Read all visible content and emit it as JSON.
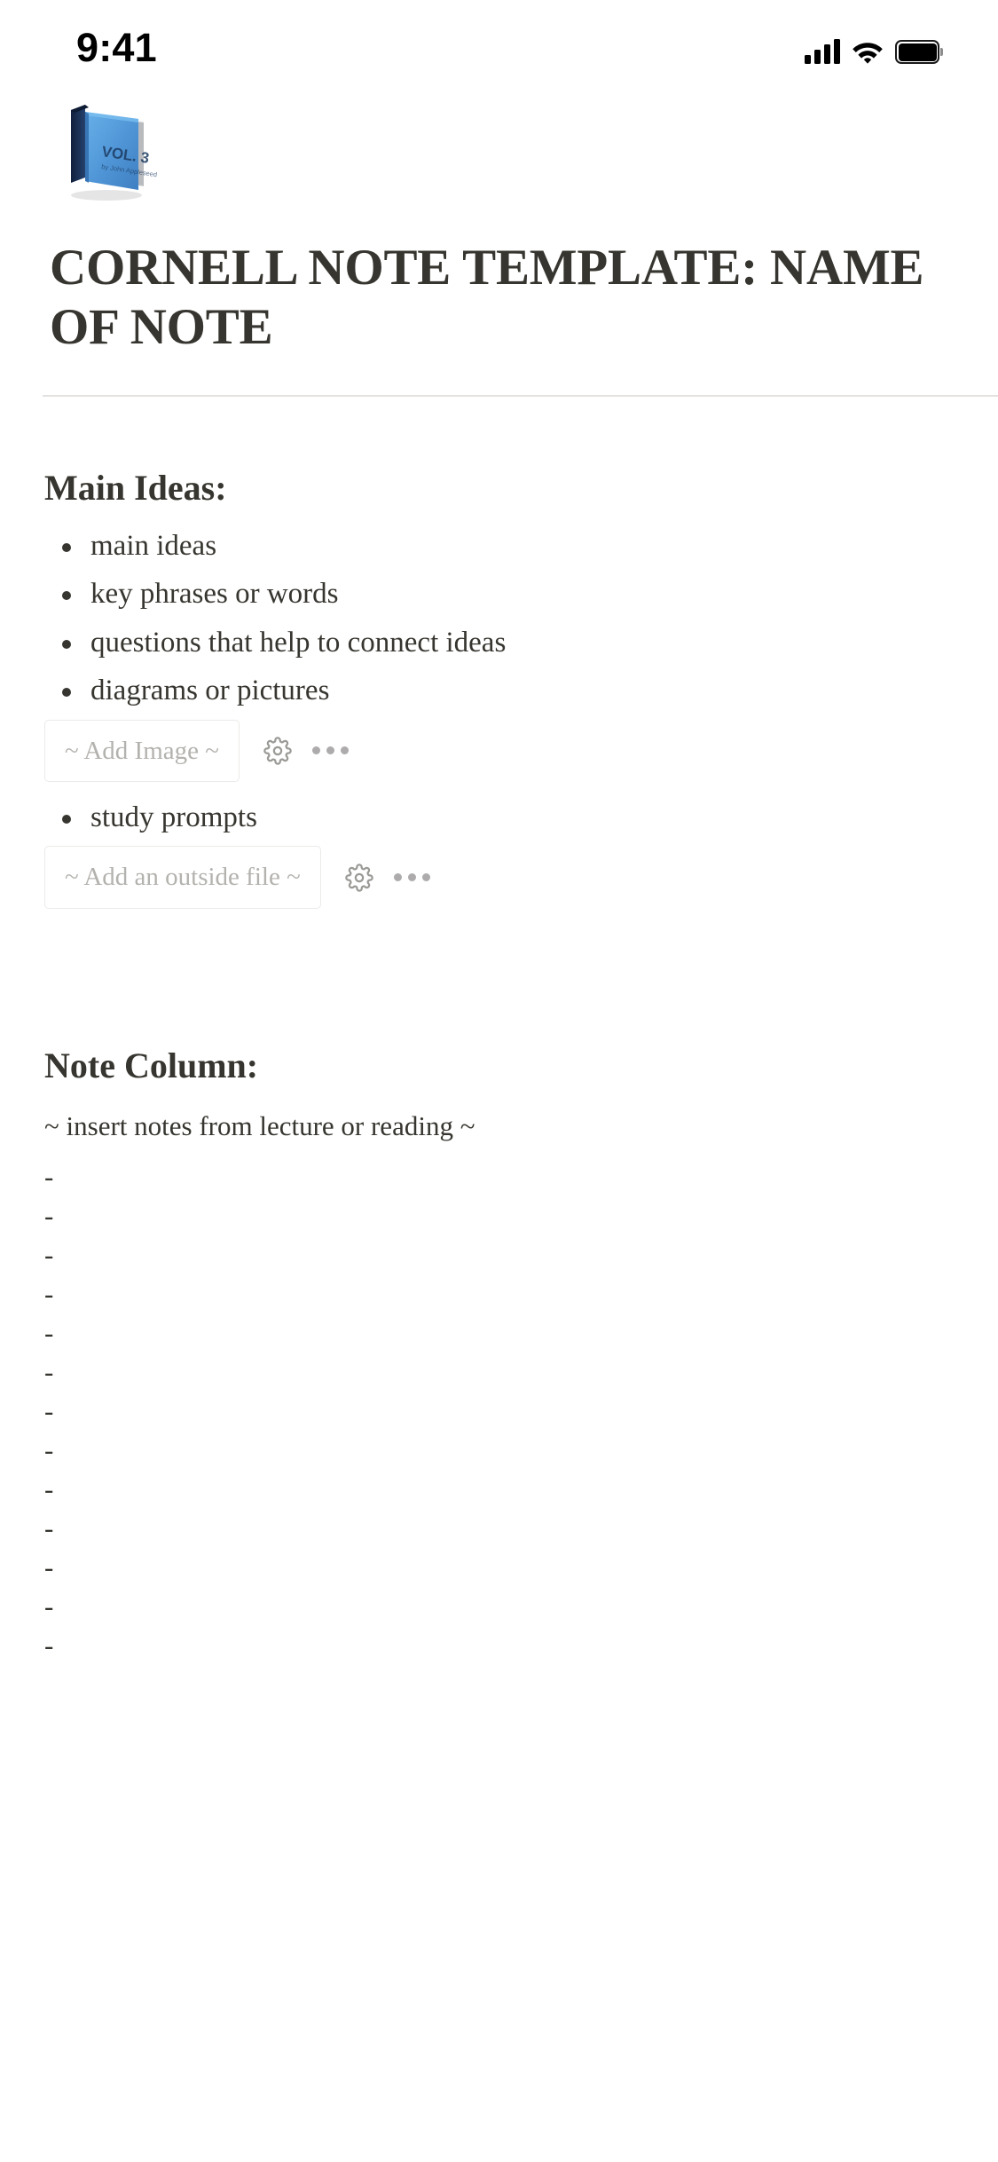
{
  "status_bar": {
    "time": "9:41",
    "signal_icon": "cellular-signal-icon",
    "wifi_icon": "wifi-icon",
    "battery_icon": "battery-full-icon"
  },
  "page": {
    "icon": "blue-book-emoji",
    "icon_glyph": "📘",
    "icon_cover_text": "VOL. 3",
    "icon_cover_subtext": "by John Appleseed",
    "title": "CORNELL NOTE TEMPLATE: NAME OF NOTE",
    "text_color": "#37352f",
    "divider_color": "#e3e2e0",
    "placeholder_color": "#b4b2ae"
  },
  "main_ideas": {
    "heading": "Main Ideas:",
    "bullets_before_image": [
      "main ideas",
      "key phrases or words",
      "questions that help to connect ideas",
      "diagrams or pictures"
    ],
    "image_embed": {
      "label": "~ Add Image ~",
      "gear_icon": "gear-icon",
      "more_icon": "more-options-icon"
    },
    "bullets_after_image": [
      "study prompts"
    ],
    "file_embed": {
      "label": "~ Add an outside file ~",
      "gear_icon": "gear-icon",
      "more_icon": "more-options-icon"
    }
  },
  "note_column": {
    "heading": "Note Column:",
    "caption": "~ insert notes from lecture or reading ~",
    "lines": [
      "-",
      "-",
      "-",
      "-",
      "-",
      "-",
      "-",
      "-",
      "-",
      "-",
      "-",
      "-",
      "-"
    ]
  }
}
